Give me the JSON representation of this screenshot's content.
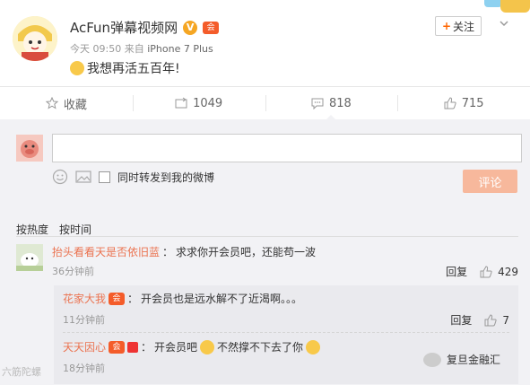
{
  "post": {
    "author": "AcFun弹幕视频网",
    "verified_mark": "V",
    "vip_mark": "会",
    "time": "今天 09:50",
    "from_label": "来自",
    "source": "iPhone 7 Plus",
    "text": "我想再活五百年!",
    "follow_label": "关注",
    "follow_plus": "+"
  },
  "actions": {
    "favorite": "收藏",
    "repost_count": "1049",
    "comment_count": "818",
    "like_count": "715"
  },
  "compose": {
    "placeholder": "",
    "forward_label": "同时转发到我的微博",
    "submit_label": "评论"
  },
  "sort": {
    "by_hot": "按热度",
    "by_time": "按时间"
  },
  "comments": [
    {
      "author": "抬头看看天是否依旧蓝",
      "sep": "：",
      "text": "求求你开会员吧，还能苟一波",
      "time": "36分钟前",
      "reply_label": "回复",
      "likes": "429"
    }
  ],
  "replies": [
    {
      "author": "花家大我",
      "sep": "：",
      "text": "开会员也是远水解不了近渴啊。。。",
      "time": "11分钟前",
      "reply_label": "回复",
      "likes": "7"
    },
    {
      "author": "天天因心",
      "sep": "：",
      "text_a": "开会员吧",
      "text_b": "不然撑不下去了你",
      "time": "18分钟前"
    }
  ],
  "watermark": {
    "left": "六筋陀螺",
    "right": "复旦金融汇"
  },
  "colors": {
    "accent": "#eb7350",
    "submit_bg": "#f7b89c",
    "panel_bg": "#f2f2f5"
  }
}
